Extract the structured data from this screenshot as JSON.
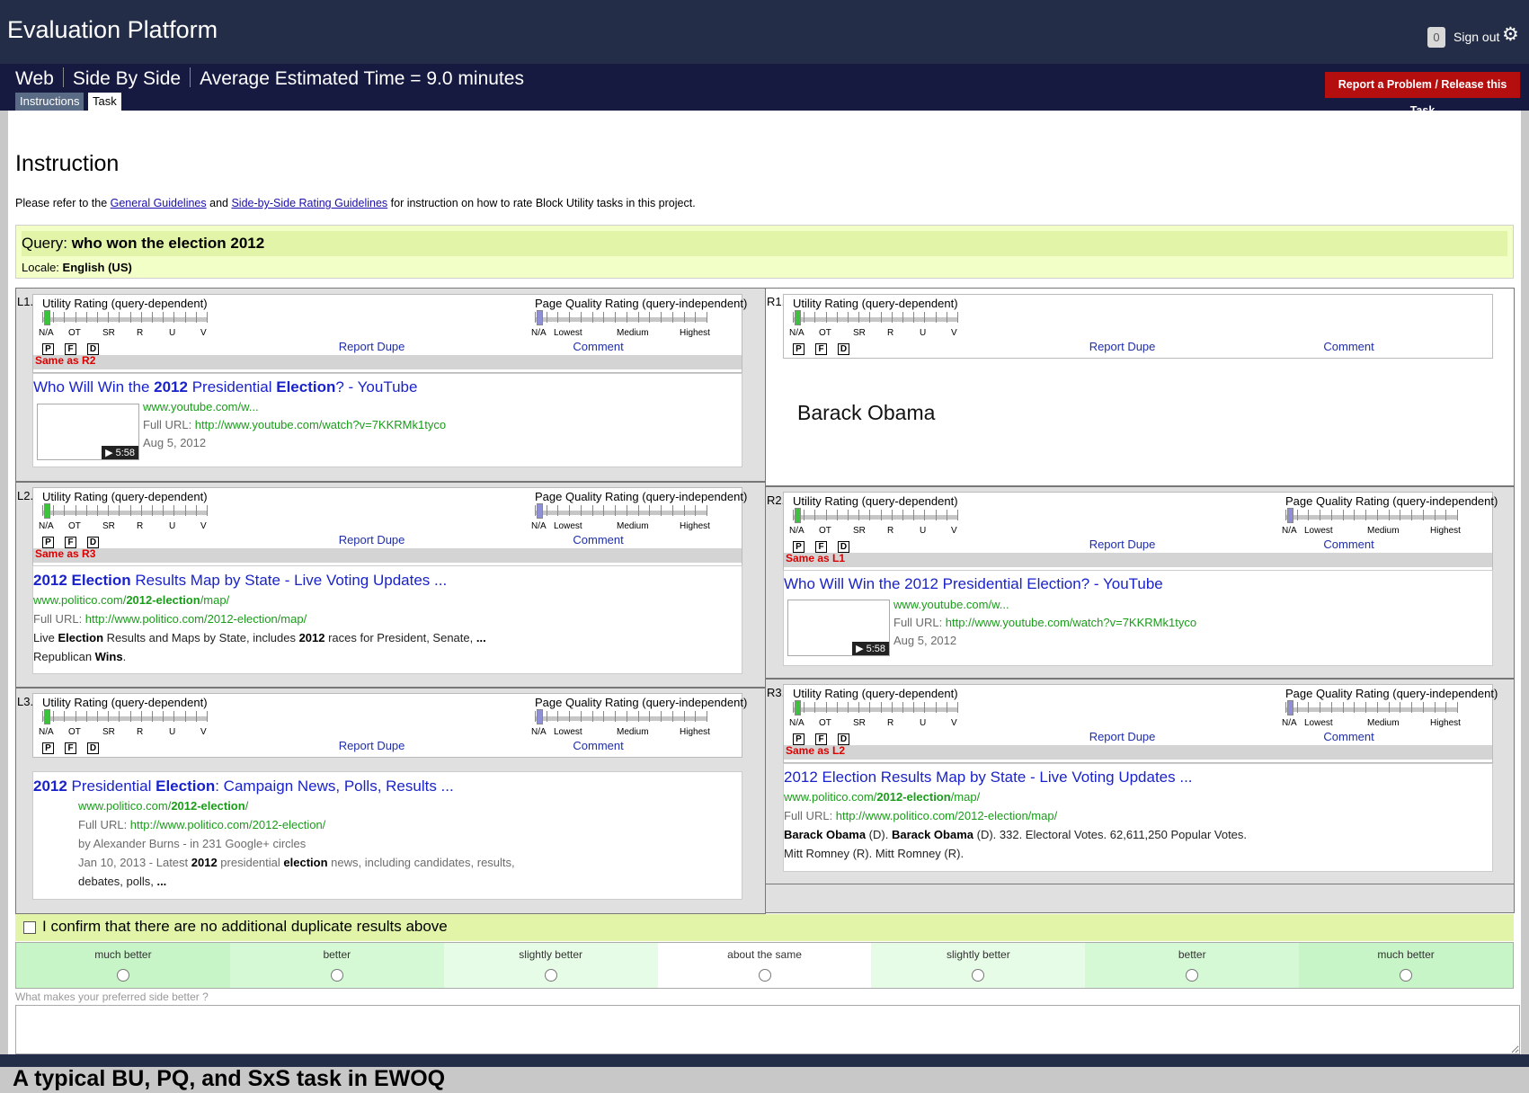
{
  "app_title": "Evaluation Platform",
  "header": {
    "badge": "0",
    "sign_out": "Sign out",
    "report_button": "Report a Problem / Release this Task"
  },
  "task": {
    "crumbs": [
      "Web",
      "Side By Side",
      "Average Estimated Time = 9.0 minutes"
    ],
    "tabs": [
      "Instructions",
      "Task"
    ]
  },
  "instruction": {
    "heading": "Instruction",
    "pre": "Please refer to the ",
    "link1": "General Guidelines",
    "mid": " and ",
    "link2": "Side-by-Side Rating Guidelines",
    "post": " for instruction on how to rate Block Utility tasks in this project."
  },
  "query": {
    "label": "Query:",
    "text": "who won the election 2012",
    "locale_label": "Locale:",
    "locale": "English (US)"
  },
  "rating": {
    "util_title": "Utility Rating (query-dependent)",
    "pq_title": "Page Quality Rating (query-independent)",
    "util_scale": [
      "N/A",
      "OT",
      "SR",
      "R",
      "U",
      "V"
    ],
    "pq_scale": [
      "N/A",
      "Lowest",
      "Medium",
      "Highest"
    ],
    "flags": [
      "P",
      "F",
      "D"
    ],
    "report_dupe": "Report Dupe",
    "comment": "Comment"
  },
  "left": [
    {
      "label": "L1.",
      "same_as": "Same as R2",
      "title_parts": [
        "Who Will Win the ",
        "2012",
        " Presidential ",
        "Election",
        "? - YouTube"
      ],
      "visible_url": "www.youtube.com/w...",
      "full_url_label": "Full URL: ",
      "full_url": "http://www.youtube.com/watch?v=7KKRMk1tyco",
      "date": "Aug 5, 2012",
      "duration": "▶ 5:58"
    },
    {
      "label": "L2.",
      "same_as": "Same as R3",
      "title_parts": [
        "2012 Election",
        " Results Map by State - Live Voting Updates ..."
      ],
      "url_parts": [
        "www.politico.com/",
        "2012-election",
        "/map/"
      ],
      "full_url_label": "Full URL: ",
      "full_url": "http://www.politico.com/2012-election/map/",
      "snippet1": [
        "Live ",
        "Election",
        " Results and Maps by State, includes ",
        "2012",
        " races for President, Senate, ",
        "..."
      ],
      "snippet2": [
        "Republican ",
        "Wins",
        "."
      ]
    },
    {
      "label": "L3.",
      "title_parts": [
        "2012",
        " Presidential ",
        "Election",
        ": Campaign News, Polls, Results ..."
      ],
      "url_parts": [
        "www.politico.com/",
        "2012-election",
        "/"
      ],
      "full_url_label": "Full URL: ",
      "full_url": "http://www.politico.com/2012-election/",
      "byline": "by Alexander Burns - in 231 Google+ circles",
      "snippet1": [
        "Jan 10, 2013 - Latest ",
        "2012",
        " presidential ",
        "election",
        " news, including candidates, results,"
      ],
      "snippet2": [
        "debates, polls, ",
        "..."
      ]
    }
  ],
  "right": [
    {
      "label": "R1.",
      "answer": "Barack Obama"
    },
    {
      "label": "R2.",
      "same_as": "Same as L1",
      "title": "Who Will Win the 2012 Presidential Election? - YouTube",
      "visible_url": "www.youtube.com/w...",
      "full_url_label": "Full URL: ",
      "full_url": "http://www.youtube.com/watch?v=7KKRMk1tyco",
      "date": "Aug 5, 2012",
      "duration": "▶ 5:58"
    },
    {
      "label": "R3.",
      "same_as": "Same as L2",
      "title": "2012 Election Results Map by State - Live Voting Updates ...",
      "url_parts": [
        "www.politico.com/",
        "2012-election",
        "/map/"
      ],
      "full_url_label": "Full URL: ",
      "full_url": "http://www.politico.com/2012-election/map/",
      "snippet1": [
        "Barack Obama",
        " (D). ",
        "Barack Obama",
        " (D). 332. Electoral Votes. 62,611,250 Popular Votes."
      ],
      "snippet2": "Mitt Romney (R). Mitt Romney (R)."
    }
  ],
  "confirm": "I confirm that there are no additional duplicate results above",
  "sxs": {
    "options": [
      "much better",
      "better",
      "slightly better",
      "about the same",
      "slightly better",
      "better",
      "much better"
    ],
    "colors": [
      "#c7f5c7",
      "#d5f9d5",
      "#e6fce6",
      "#ffffff",
      "#e6fce6",
      "#d5f9d5",
      "#c7f5c7"
    ],
    "why_placeholder": "What makes your preferred side better ?"
  },
  "caption": "A typical BU, PQ, and SxS task in EWOQ",
  "icons": {
    "settings": "gear-icon"
  }
}
